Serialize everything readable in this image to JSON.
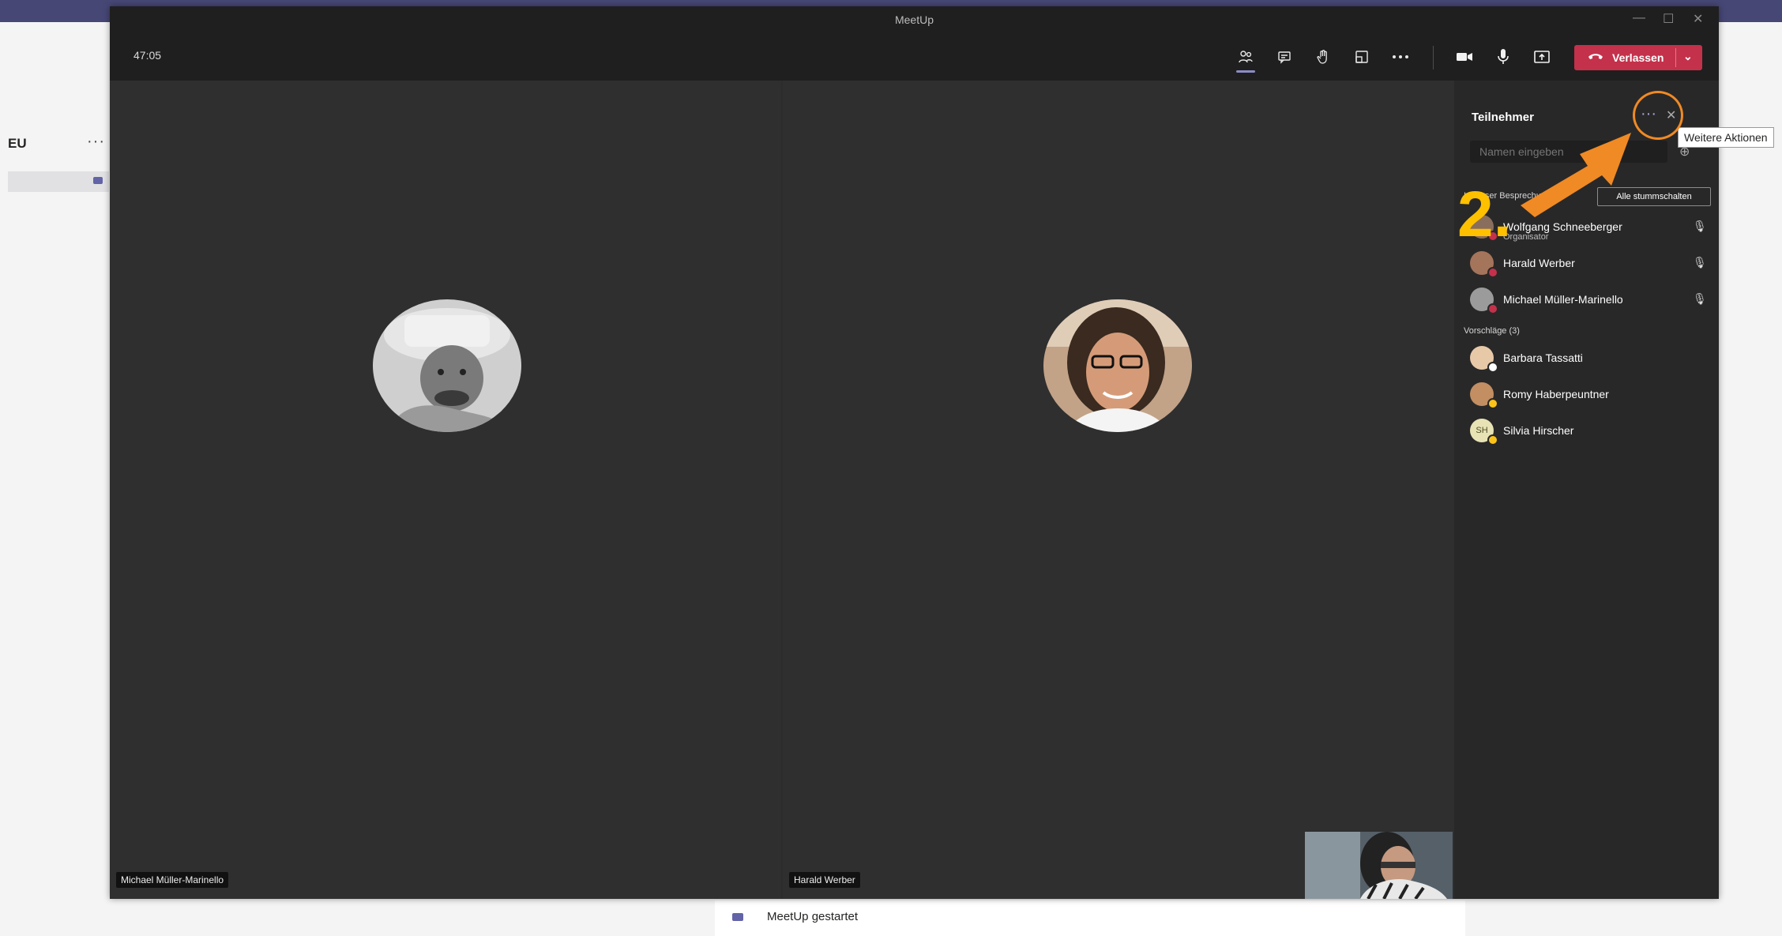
{
  "background": {
    "title": "EU",
    "more": "···",
    "feed_item": "MeetUp gestartet",
    "tooltip": "Weitere Aktionen"
  },
  "window": {
    "title": "MeetUp",
    "timer": "47:05",
    "controls": [
      "—",
      "☐",
      "✕"
    ]
  },
  "toolbar": {
    "icons": [
      "participants-icon",
      "chat-icon",
      "raise-hand-icon",
      "share-tray-icon",
      "more-icon",
      "camera-icon",
      "mic-icon",
      "share-screen-icon"
    ],
    "leave_label": "Verlassen"
  },
  "stage": {
    "tiles": [
      {
        "name": "Michael Müller-Marinello"
      },
      {
        "name": "Harald Werber"
      }
    ]
  },
  "panel": {
    "title": "Teilnehmer",
    "search_placeholder": "Namen eingeben",
    "in_meeting_label": "In dieser Besprechung (3)",
    "mute_all_label": "Alle stummschalten",
    "in_meeting": [
      {
        "name": "Wolfgang Schneeberger",
        "role": "Organisator",
        "status_color": "#c4314b"
      },
      {
        "name": "Harald Werber",
        "role": "",
        "status_color": "#c4314b"
      },
      {
        "name": "Michael Müller-Marinello",
        "role": "",
        "status_color": "#c4314b"
      }
    ],
    "suggestions_label": "Vorschläge (3)",
    "suggestions": [
      {
        "name": "Barbara Tassatti",
        "status_color": "#ffffff",
        "initials": ""
      },
      {
        "name": "Romy Haberpeuntner",
        "status_color": "#fcc419",
        "initials": ""
      },
      {
        "name": "Silvia Hirscher",
        "status_color": "#fcc419",
        "initials": "SH"
      }
    ]
  },
  "annotation": {
    "step": "2.",
    "color": "#f08a24"
  }
}
